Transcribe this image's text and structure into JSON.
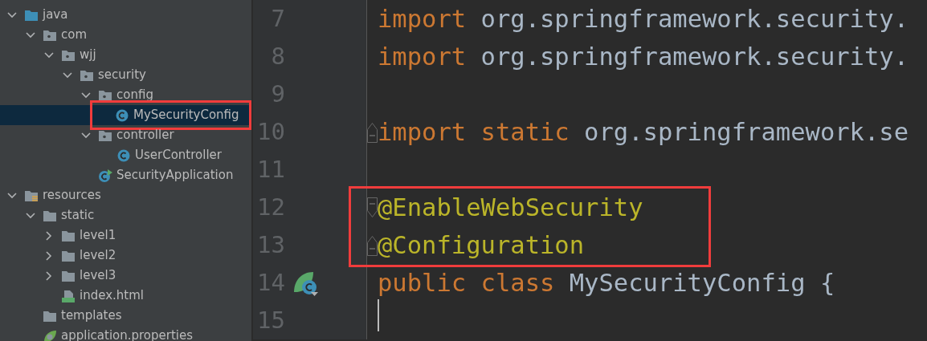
{
  "project_tree": {
    "items": [
      {
        "label": "java",
        "kind": "source-folder",
        "expanded": true,
        "selected": false,
        "marked": false,
        "children": [
          {
            "label": "com",
            "kind": "package",
            "expanded": true,
            "selected": false,
            "marked": false,
            "children": [
              {
                "label": "wjj",
                "kind": "package",
                "expanded": true,
                "selected": false,
                "marked": false,
                "children": [
                  {
                    "label": "security",
                    "kind": "package",
                    "expanded": true,
                    "selected": false,
                    "marked": false,
                    "children": [
                      {
                        "label": "config",
                        "kind": "package",
                        "expanded": true,
                        "selected": false,
                        "marked": false,
                        "children": [
                          {
                            "label": "MySecurityConfig",
                            "kind": "class",
                            "selected": true,
                            "marked": true
                          }
                        ]
                      },
                      {
                        "label": "controller",
                        "kind": "package",
                        "expanded": true,
                        "selected": false,
                        "marked": false,
                        "children": [
                          {
                            "label": "UserController",
                            "kind": "class",
                            "selected": false,
                            "marked": false
                          }
                        ]
                      },
                      {
                        "label": "SecurityApplication",
                        "kind": "app-class",
                        "selected": false,
                        "marked": false
                      }
                    ]
                  }
                ]
              }
            ]
          }
        ]
      },
      {
        "label": "resources",
        "kind": "resources-folder",
        "expanded": true,
        "selected": false,
        "marked": false,
        "children": [
          {
            "label": "static",
            "kind": "folder",
            "expanded": true,
            "selected": false,
            "marked": false,
            "children": [
              {
                "label": "level1",
                "kind": "folder",
                "expanded": false,
                "selected": false,
                "marked": false
              },
              {
                "label": "level2",
                "kind": "folder",
                "expanded": false,
                "selected": false,
                "marked": false
              },
              {
                "label": "level3",
                "kind": "folder",
                "expanded": false,
                "selected": false,
                "marked": false
              },
              {
                "label": "index.html",
                "kind": "html",
                "selected": false,
                "marked": false
              }
            ]
          },
          {
            "label": "templates",
            "kind": "folder",
            "selected": false,
            "marked": false
          },
          {
            "label": "application.properties",
            "kind": "properties",
            "selected": false,
            "marked": false
          }
        ]
      }
    ]
  },
  "editor": {
    "lines": [
      {
        "number": "7",
        "marked": false,
        "tokens": [
          {
            "kind": "keyword",
            "text": "import"
          },
          {
            "kind": "plain",
            "text": " org.springframework.security."
          }
        ]
      },
      {
        "number": "8",
        "marked": false,
        "tokens": [
          {
            "kind": "keyword",
            "text": "import"
          },
          {
            "kind": "plain",
            "text": " org.springframework.security."
          }
        ]
      },
      {
        "number": "9",
        "marked": false
      },
      {
        "number": "10",
        "fold_end": true,
        "marked": false,
        "tokens": [
          {
            "kind": "keyword",
            "text": "import static"
          },
          {
            "kind": "plain",
            "text": " org.springframework.se"
          }
        ]
      },
      {
        "number": "11",
        "marked": false
      },
      {
        "number": "12",
        "fold_start": true,
        "marked": true,
        "tokens": [
          {
            "kind": "annotation",
            "text": "@EnableWebSecurity"
          }
        ]
      },
      {
        "number": "13",
        "fold_end": true,
        "marked": true,
        "tokens": [
          {
            "kind": "annotation",
            "text": "@Configuration"
          }
        ]
      },
      {
        "number": "14",
        "marked": false,
        "bean_marker": true,
        "tokens": [
          {
            "kind": "keyword",
            "text": "public class"
          },
          {
            "kind": "plain",
            "text": " MySecurityConfig {"
          }
        ]
      },
      {
        "number": "15",
        "marked": false,
        "caret": true
      }
    ]
  }
}
